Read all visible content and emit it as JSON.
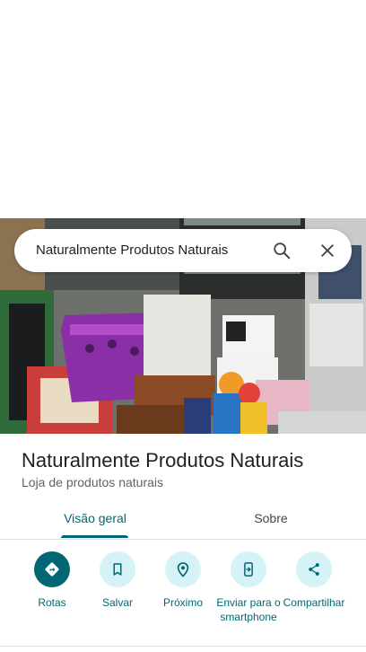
{
  "search": {
    "query": "Naturalmente Produtos Naturais",
    "search_icon": "search-icon",
    "close_icon": "close-icon"
  },
  "place": {
    "name": "Naturalmente Produtos Naturais",
    "category": "Loja de produtos naturais"
  },
  "tabs": [
    {
      "label": "Visão geral",
      "active": true
    },
    {
      "label": "Sobre",
      "active": false
    }
  ],
  "actions": [
    {
      "label": "Rotas",
      "icon": "directions-icon"
    },
    {
      "label": "Salvar",
      "icon": "bookmark-icon"
    },
    {
      "label": "Próximo",
      "icon": "nearby-icon"
    },
    {
      "label": "Enviar para o smartphone",
      "icon": "send-to-phone-icon"
    },
    {
      "label": "Compartilhar",
      "icon": "share-icon"
    }
  ],
  "colors": {
    "accent": "#006874",
    "action_bg": "#d5f3f6"
  }
}
